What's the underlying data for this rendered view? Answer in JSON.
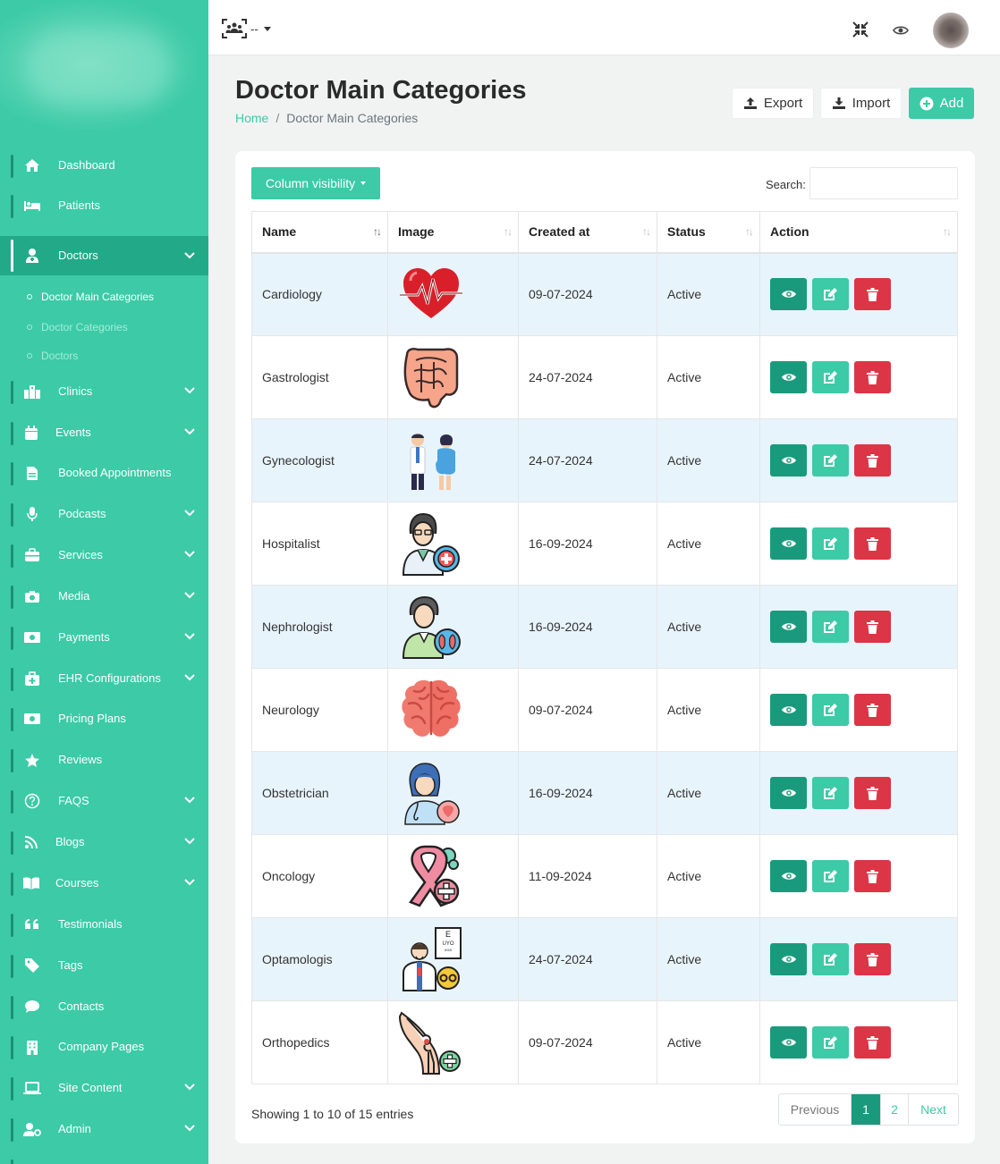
{
  "sidebar": {
    "items": [
      {
        "label": "Dashboard",
        "icon": "home-icon"
      },
      {
        "label": "Patients",
        "icon": "bed-icon"
      },
      {
        "label": "Doctors",
        "icon": "doctor-icon"
      },
      {
        "label": "Clinics",
        "icon": "building-icon"
      },
      {
        "label": "Events",
        "icon": "calendar-icon"
      },
      {
        "label": "Booked Appointments",
        "icon": "file-icon"
      },
      {
        "label": "Podcasts",
        "icon": "microphone-icon"
      },
      {
        "label": "Services",
        "icon": "briefcase-icon"
      },
      {
        "label": "Media",
        "icon": "camera-icon"
      },
      {
        "label": "Payments",
        "icon": "money-icon"
      },
      {
        "label": "EHR Configurations",
        "icon": "medkit-icon"
      },
      {
        "label": "Pricing Plans",
        "icon": "money-bill-icon"
      },
      {
        "label": "Reviews",
        "icon": "star-icon"
      },
      {
        "label": "FAQS",
        "icon": "question-icon"
      },
      {
        "label": "Blogs",
        "icon": "rss-icon"
      },
      {
        "label": "Courses",
        "icon": "book-icon"
      },
      {
        "label": "Testimonials",
        "icon": "quote-icon"
      },
      {
        "label": "Tags",
        "icon": "tag-icon"
      },
      {
        "label": "Contacts",
        "icon": "comment-icon"
      },
      {
        "label": "Company Pages",
        "icon": "building-icon"
      },
      {
        "label": "Site Content",
        "icon": "laptop-icon"
      },
      {
        "label": "Admin",
        "icon": "user-cog-icon"
      }
    ],
    "sub_items": [
      "Doctor Main Categories",
      "Doctor Categories",
      "Doctors"
    ]
  },
  "topbar": {
    "selector_text": "--"
  },
  "header": {
    "title": "Doctor Main Categories",
    "breadcrumb_home": "Home",
    "breadcrumb_sep": "/",
    "breadcrumb_current": "Doctor Main Categories",
    "export_label": "Export",
    "import_label": "Import",
    "add_label": "Add"
  },
  "table": {
    "column_visibility_label": "Column visibility",
    "search_label": "Search:",
    "columns": [
      "Name",
      "Image",
      "Created at",
      "Status",
      "Action"
    ],
    "rows": [
      {
        "name": "Cardiology",
        "image": "heart-icon",
        "created_at": "09-07-2024",
        "status": "Active"
      },
      {
        "name": "Gastrologist",
        "image": "intestine-icon",
        "created_at": "24-07-2024",
        "status": "Active"
      },
      {
        "name": "Gynecologist",
        "image": "gynecologist-icon",
        "created_at": "24-07-2024",
        "status": "Active"
      },
      {
        "name": "Hospitalist",
        "image": "hospitalist-icon",
        "created_at": "16-09-2024",
        "status": "Active"
      },
      {
        "name": "Nephrologist",
        "image": "nephrologist-icon",
        "created_at": "16-09-2024",
        "status": "Active"
      },
      {
        "name": "Neurology",
        "image": "brain-icon",
        "created_at": "09-07-2024",
        "status": "Active"
      },
      {
        "name": "Obstetrician",
        "image": "obstetrician-icon",
        "created_at": "16-09-2024",
        "status": "Active"
      },
      {
        "name": "Oncology",
        "image": "ribbon-icon",
        "created_at": "11-09-2024",
        "status": "Active"
      },
      {
        "name": "Optamologis",
        "image": "eye-chart-icon",
        "created_at": "24-07-2024",
        "status": "Active"
      },
      {
        "name": "Orthopedics",
        "image": "knee-joint-icon",
        "created_at": "09-07-2024",
        "status": "Active"
      }
    ],
    "showing_text": "Showing 1 to 10 of 15 entries",
    "pagination": {
      "previous": "Previous",
      "pages": [
        "1",
        "2"
      ],
      "next": "Next",
      "current": "1"
    }
  },
  "colors": {
    "primary": "#3ccaa7",
    "dark": "#1a9a7c",
    "danger": "#dc3545"
  }
}
